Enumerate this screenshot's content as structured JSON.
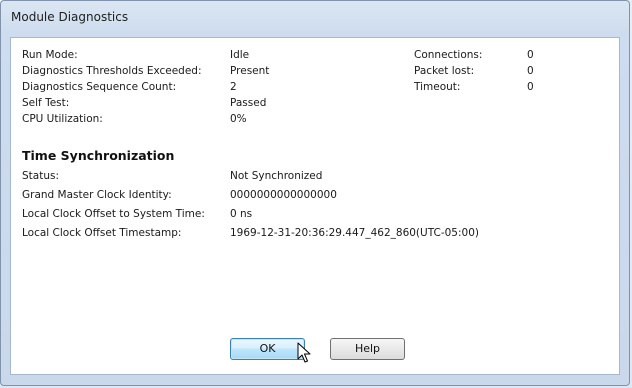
{
  "window": {
    "title": "Module Diagnostics"
  },
  "diagnostics": {
    "run_mode_label": "Run Mode:",
    "run_mode_value": "Idle",
    "thresholds_label": "Diagnostics Thresholds Exceeded:",
    "thresholds_value": "Present",
    "sequence_label": "Diagnostics Sequence Count:",
    "sequence_value": "2",
    "self_test_label": "Self Test:",
    "self_test_value": "Passed",
    "cpu_label": "CPU Utilization:",
    "cpu_value": "0%",
    "connections_label": "Connections:",
    "connections_value": "0",
    "packet_lost_label": "Packet lost:",
    "packet_lost_value": "0",
    "timeout_label": "Timeout:",
    "timeout_value": "0"
  },
  "time_sync": {
    "heading": "Time Synchronization",
    "status_label": "Status:",
    "status_value": "Not Synchronized",
    "gm_label": "Grand Master Clock Identity:",
    "gm_value": "0000000000000000",
    "offset_label": "Local Clock Offset to System Time:",
    "offset_value": "0 ns",
    "timestamp_label": "Local Clock Offset Timestamp:",
    "timestamp_value": "1969-12-31-20:36:29.447_462_860(UTC-05:00)"
  },
  "buttons": {
    "ok_label": "OK",
    "help_label": "Help"
  },
  "icons": {
    "cursor": "arrow-cursor-icon"
  }
}
